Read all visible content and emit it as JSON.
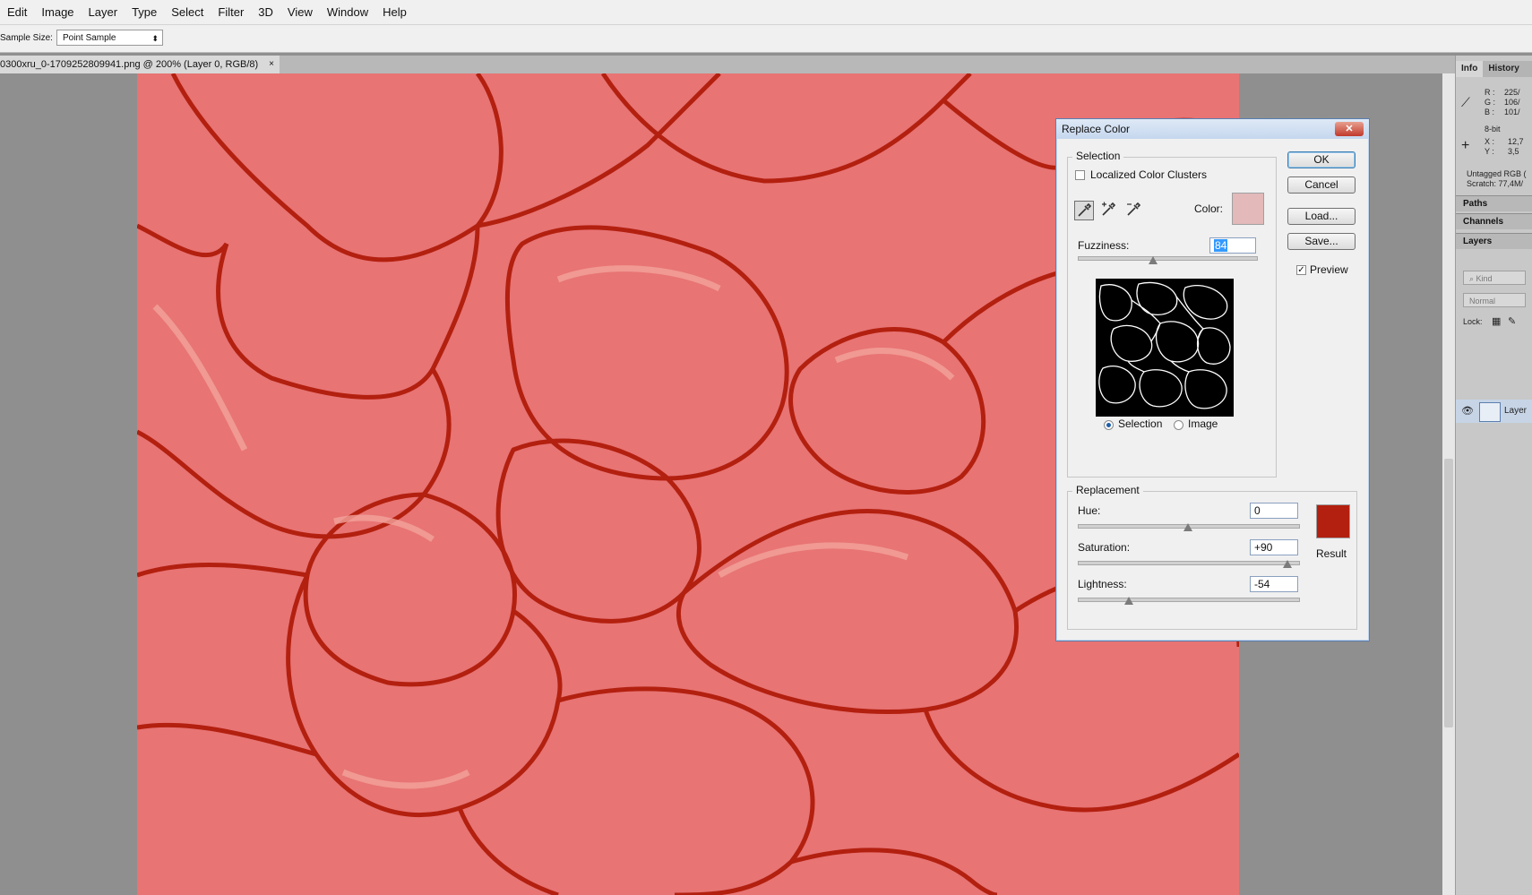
{
  "menu": [
    "Edit",
    "Image",
    "Layer",
    "Type",
    "Select",
    "Filter",
    "3D",
    "View",
    "Window",
    "Help"
  ],
  "options": {
    "sample_size_label": "Sample Size:",
    "sample_size_value": "Point Sample"
  },
  "document_tab": {
    "title": "0300xru_0-1709252809941.png @ 200% (Layer 0, RGB/8)",
    "close": "×"
  },
  "info_panel": {
    "tabs": [
      "Info",
      "History"
    ],
    "r": "R :",
    "r_val": "225/",
    "g": "G :",
    "g_val": "106/",
    "b": "B :",
    "b_val": "101/",
    "bitdepth": "8-bit",
    "x": "X :",
    "x_val": "12,7",
    "y": "Y :",
    "y_val": "3,5",
    "profile": "Untagged RGB (",
    "scratch": "Scratch: 77,4M/"
  },
  "panels": {
    "paths": "Paths",
    "channels": "Channels",
    "layers": "Layers",
    "kind_placeholder": "Kind",
    "blend_mode": "Normal",
    "lock_label": "Lock:",
    "layer_name": "Layer"
  },
  "dialog": {
    "title": "Replace Color",
    "close": "✕",
    "selection_group": "Selection",
    "localized_clusters": "Localized Color Clusters",
    "localized_checked": false,
    "color_label": "Color:",
    "sample_color": "#e3b9b9",
    "fuzziness_label": "Fuzziness:",
    "fuzziness_value": "84",
    "fuzziness_level": 0.42,
    "radio_selection": "Selection",
    "radio_image": "Image",
    "radio_selected": "Selection",
    "replacement_group": "Replacement",
    "hue_label": "Hue:",
    "hue_value": "0",
    "hue_level": 0.5,
    "saturation_label": "Saturation:",
    "saturation_value": "+90",
    "saturation_level": 0.95,
    "lightness_label": "Lightness:",
    "lightness_value": "-54",
    "lightness_level": 0.23,
    "result_label": "Result",
    "result_color": "#b3200f",
    "buttons": {
      "ok": "OK",
      "cancel": "Cancel",
      "load": "Load...",
      "save": "Save..."
    },
    "preview_label": "Preview",
    "preview_checked": true
  },
  "colors": {
    "artwork_fill": "#e87474",
    "artwork_stroke": "#b3200f",
    "menubar": "#f0f0f0"
  }
}
